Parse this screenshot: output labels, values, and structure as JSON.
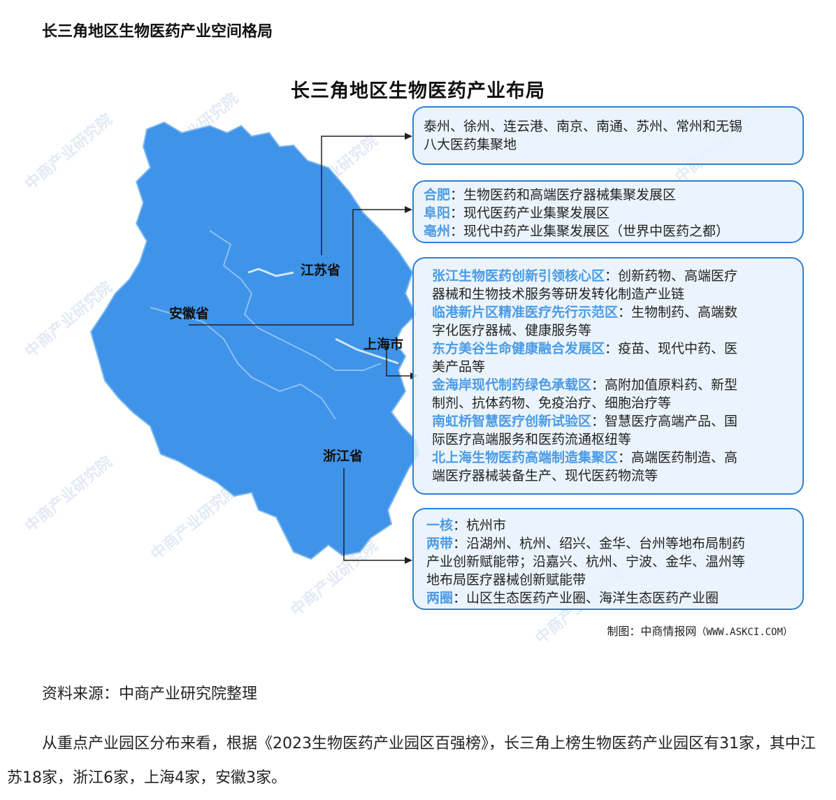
{
  "heading": "长三角地区生物医药产业空间格局",
  "figure": {
    "title": "长三角地区生物医药产业布局",
    "provinces": {
      "jiangsu": "江苏省",
      "anhui": "安徽省",
      "shanghai": "上海市",
      "zhejiang": "浙江省"
    },
    "boxes": {
      "jiangsu": {
        "line1": "泰州、徐州、连云港、南京、南通、苏州、常州和无锡",
        "line2": "八大医药集聚地"
      },
      "anhui": [
        {
          "name": "合肥",
          "text": "：生物医药和高端医疗器械集聚发展区"
        },
        {
          "name": "阜阳",
          "text": "：现代医药产业集聚发展区"
        },
        {
          "name": "亳州",
          "text": "：现代中药产业集聚发展区（世界中医药之都）"
        }
      ],
      "shanghai": [
        {
          "name": "张江生物医药创新引领核心区",
          "text": "：创新药物、高端医疗",
          "cont": "器械和生物技术服务等研发转化制造产业链"
        },
        {
          "name": "临港新片区精准医疗先行示范区",
          "text": "：生物制药、高端数",
          "cont": "字化医疗器械、健康服务等"
        },
        {
          "name": "东方美谷生命健康融合发展区",
          "text": "：疫苗、现代中药、医",
          "cont": "美产品等"
        },
        {
          "name": "金海岸现代制药绿色承载区",
          "text": "：高附加值原料药、新型",
          "cont": "制剂、抗体药物、免疫治疗、细胞治疗等"
        },
        {
          "name": "南虹桥智慧医疗创新试验区",
          "text": "：智慧医疗高端产品、国",
          "cont": "际医疗高端服务和医药流通枢纽等"
        },
        {
          "name": "北上海生物医药高端制造集聚区",
          "text": "：高端医药制造、高",
          "cont": "端医疗器械装备生产、现代医药物流等"
        }
      ],
      "zhejiang": [
        {
          "name": "一核",
          "text": "：杭州市",
          "cont": ""
        },
        {
          "name": "两带",
          "text": "：沿湖州、杭州、绍兴、金华、台州等地布局制药",
          "cont": "产业创新赋能带；沿嘉兴、杭州、宁波、金华、温州等",
          "cont2": "地布局医疗器械创新赋能带"
        },
        {
          "name": "两圈",
          "text": "：山区生态医药产业圈、海洋生态医药产业圈",
          "cont": ""
        }
      ]
    },
    "credit_label": "制图：中商情报网",
    "credit_url": "（WWW.ASKCI.COM）",
    "watermark": "中商产业研究院",
    "colors": {
      "map": "#3f93e8",
      "highlight": "#4b9be6",
      "border": "#2f7fd0"
    }
  },
  "source": "资料来源：中商产业研究院整理",
  "paragraph": "从重点产业园区分布来看，根据《2023生物医药产业园区百强榜》，长三角上榜生物医药产业园区有31家，其中江苏18家，浙江6家，上海4家，安徽3家。"
}
